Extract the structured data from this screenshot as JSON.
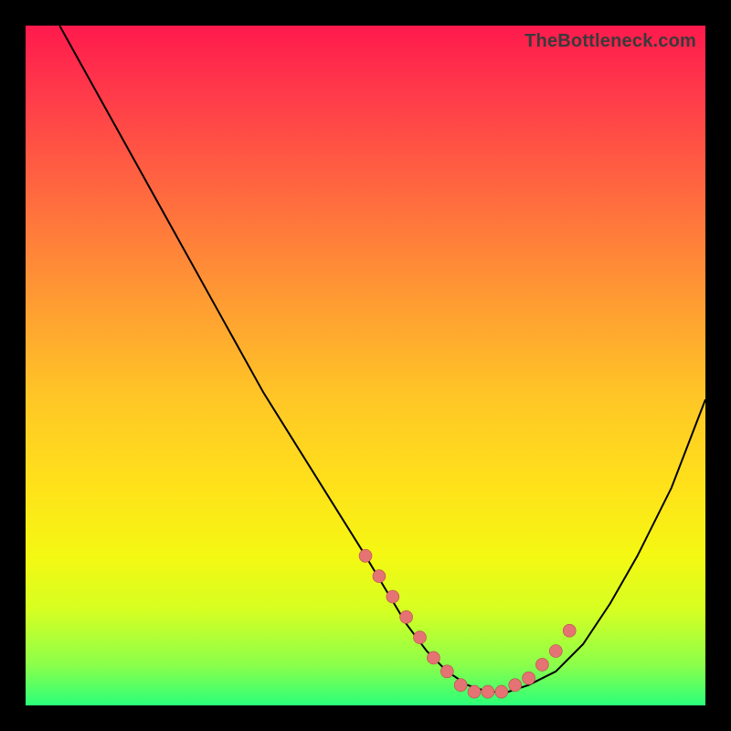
{
  "attribution": "TheBottleneck.com",
  "colors": {
    "frame": "#000000",
    "gradient_top": "#ff1a4d",
    "gradient_mid": "#ffe21a",
    "gradient_bottom": "#2bff7a",
    "curve": "#000000",
    "dot_fill": "#e57373",
    "dot_stroke": "#b84c4c"
  },
  "chart_data": {
    "type": "line",
    "title": "",
    "xlabel": "",
    "ylabel": "",
    "xlim": [
      0,
      100
    ],
    "ylim": [
      0,
      100
    ],
    "grid": false,
    "legend": false,
    "series": [
      {
        "name": "bottleneck-curve",
        "x": [
          5,
          10,
          15,
          20,
          25,
          30,
          35,
          40,
          45,
          50,
          53,
          56,
          59,
          62,
          65,
          68,
          71,
          74,
          78,
          82,
          86,
          90,
          95,
          100
        ],
        "y": [
          100,
          91,
          82,
          73,
          64,
          55,
          46,
          38,
          30,
          22,
          17,
          12,
          8,
          5,
          3,
          2,
          2,
          3,
          5,
          9,
          15,
          22,
          32,
          45
        ]
      }
    ],
    "marker_points": {
      "name": "highlighted-points",
      "x": [
        50,
        52,
        54,
        56,
        58,
        60,
        62,
        64,
        66,
        68,
        70,
        72,
        74,
        76,
        78,
        80
      ],
      "y": [
        22,
        19,
        16,
        13,
        10,
        7,
        5,
        3,
        2,
        2,
        2,
        3,
        4,
        6,
        8,
        11
      ]
    }
  }
}
